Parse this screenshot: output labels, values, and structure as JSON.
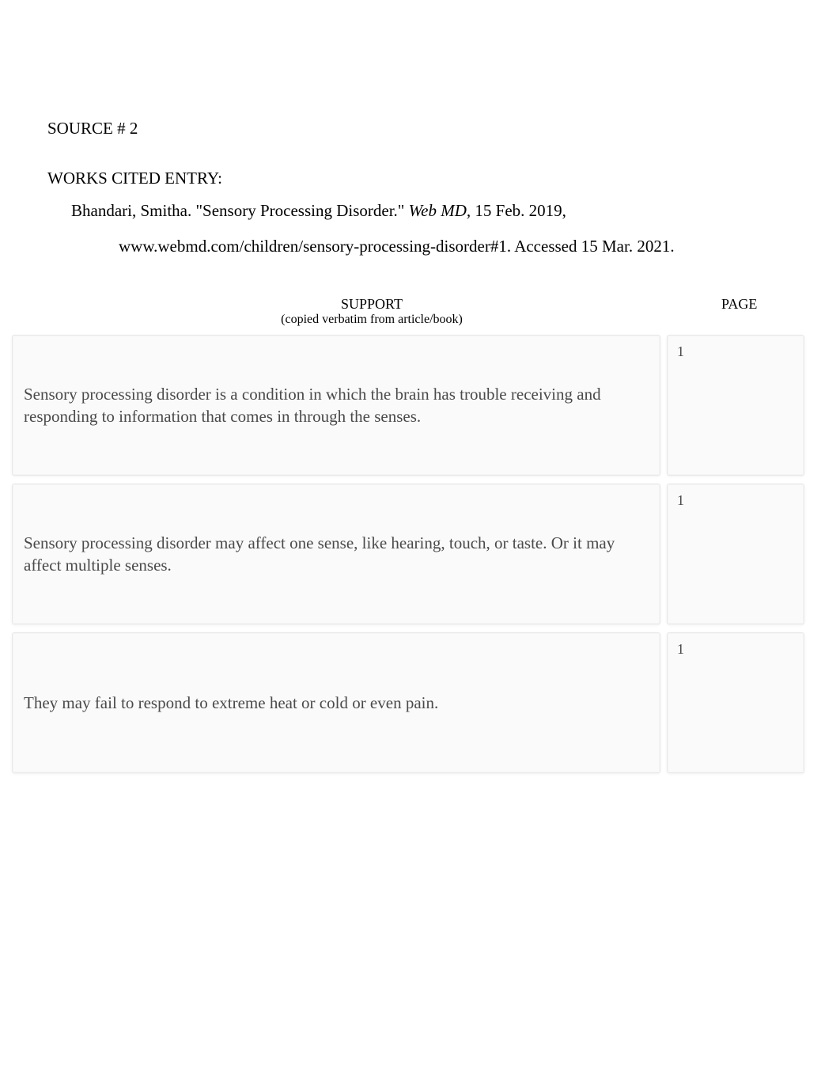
{
  "source_label": "SOURCE # 2",
  "works_cited_label": "WORKS CITED ENTRY:",
  "citation": {
    "line1_prefix": "Bhandari, Smitha. \"Sensory Processing Disorder.\"  ",
    "line1_italic": "Web MD, ",
    "line1_suffix": "15 Feb. 2019,",
    "line2": "www.webmd.com/children/sensory-processing-disorder#1. Accessed 15 Mar. 2021."
  },
  "headers": {
    "support": "SUPPORT",
    "support_sub": "(copied verbatim from article/book)",
    "page": "PAGE"
  },
  "rows": [
    {
      "support": "Sensory processing disorder is a condition in which the brain has trouble receiving and responding to information that comes in through the senses.",
      "page": "1"
    },
    {
      "support": "Sensory processing disorder may affect one sense, like hearing, touch, or taste. Or it may affect multiple senses.",
      "page": "1"
    },
    {
      "support": "They may fail to respond to extreme heat or cold or even pain.",
      "page": "1"
    }
  ]
}
